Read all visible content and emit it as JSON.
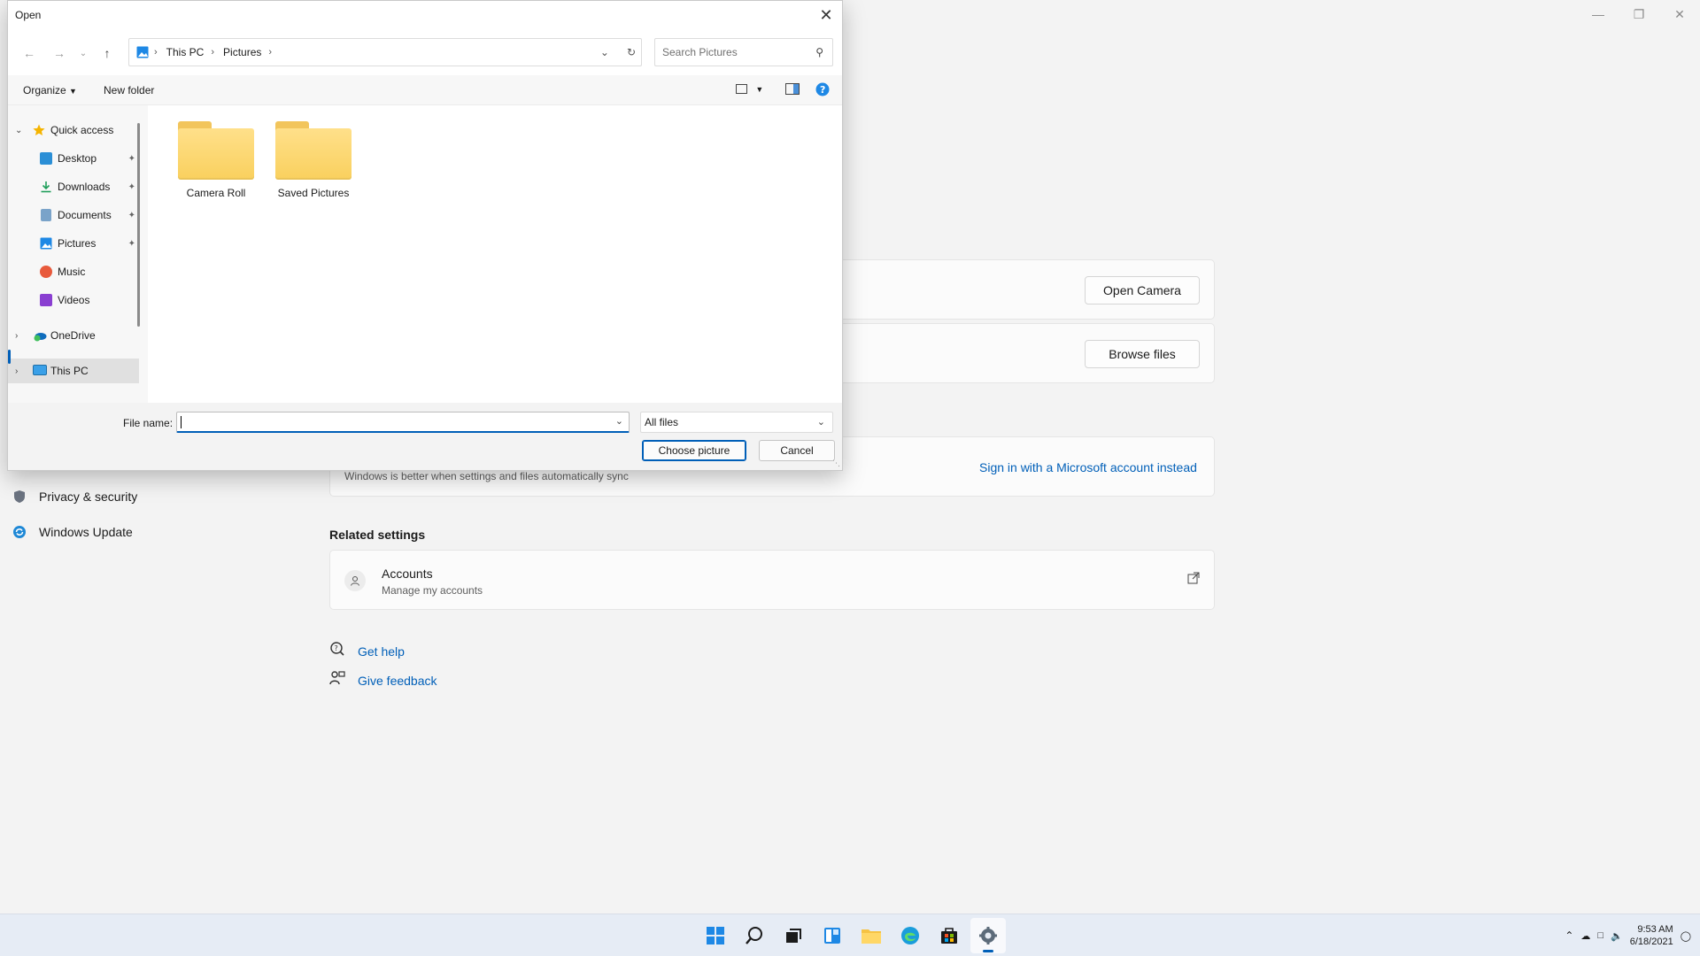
{
  "settings": {
    "nav_items": [
      {
        "label": "Privacy & security",
        "icon": "shield-icon"
      },
      {
        "label": "Windows Update",
        "icon": "update-icon"
      }
    ],
    "open_camera_label": "Open Camera",
    "browse_files_label": "Browse files",
    "sync_text": "Windows is better when settings and files automatically sync",
    "sign_in_link": "Sign in with a Microsoft account instead",
    "related_settings_title": "Related settings",
    "accounts_title": "Accounts",
    "accounts_subtitle": "Manage my accounts",
    "get_help": "Get help",
    "give_feedback": "Give feedback"
  },
  "taskbar": {
    "apps": [
      "start-icon",
      "search-icon",
      "task-view-icon",
      "widgets-icon",
      "file-explorer-icon",
      "edge-icon",
      "store-icon",
      "settings-icon"
    ],
    "active_app": "settings-icon",
    "time": "9:53 AM",
    "date": "6/18/2021",
    "accent": "#005fb8"
  },
  "dialog": {
    "title": "Open",
    "breadcrumb": [
      "This PC",
      "Pictures"
    ],
    "search_placeholder": "Search Pictures",
    "organize_label": "Organize",
    "new_folder_label": "New folder",
    "nav_items": [
      {
        "label": "Quick access",
        "icon": "star-icon"
      },
      {
        "label": "Desktop",
        "icon": "desktop-icon"
      },
      {
        "label": "Downloads",
        "icon": "download-icon"
      },
      {
        "label": "Documents",
        "icon": "document-icon"
      },
      {
        "label": "Pictures",
        "icon": "pictures-icon"
      },
      {
        "label": "Music",
        "icon": "music-icon"
      },
      {
        "label": "Videos",
        "icon": "videos-icon"
      },
      {
        "label": "OneDrive",
        "icon": "onedrive-icon"
      },
      {
        "label": "This PC",
        "icon": "computer-icon"
      }
    ],
    "selected_nav": "This PC",
    "folders": [
      "Camera Roll",
      "Saved Pictures"
    ],
    "file_name_label": "File name:",
    "file_name_value": "",
    "file_type": "All files",
    "choose_label": "Choose picture",
    "cancel_label": "Cancel"
  }
}
